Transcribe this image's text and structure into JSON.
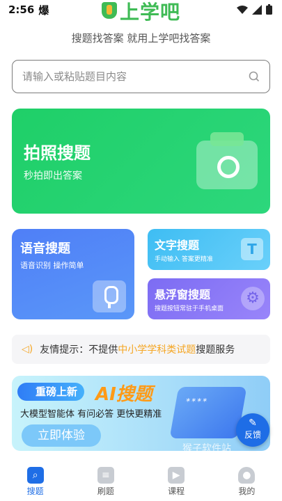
{
  "status_bar": {
    "time": "2:56",
    "extra": "爆"
  },
  "header": {
    "logo_text": "上学吧",
    "subtitle": "搜题找答案 就用上学吧找答案"
  },
  "search": {
    "placeholder": "请输入或粘贴题目内容",
    "value": ""
  },
  "cards": {
    "photo": {
      "title": "拍照搜题",
      "desc": "秒拍即出答案"
    },
    "voice": {
      "title": "语音搜题",
      "desc": "语音识别 操作简单"
    },
    "text": {
      "title": "文字搜题",
      "desc": "手动输入 答案更精准",
      "icon_glyph": "T"
    },
    "float": {
      "title": "悬浮窗搜题",
      "desc": "搜题按钮常驻于手机桌面"
    }
  },
  "notice": {
    "prefix": "友情提示：不提供",
    "highlight": "中小学学科类试题",
    "suffix": "搜题服务"
  },
  "banner": {
    "badge": "重磅上新",
    "headline": "AI搜题",
    "slogan": "大模型智能体  有问必答  更快更精准",
    "cta": "立即体验",
    "phone_text": "****"
  },
  "watermark": "猴子软件站",
  "fab": {
    "label": "反馈"
  },
  "tabs": [
    {
      "label": "搜题",
      "icon": "search-icon",
      "active": true
    },
    {
      "label": "刷题",
      "icon": "document-icon",
      "active": false
    },
    {
      "label": "课程",
      "icon": "play-icon",
      "active": false
    },
    {
      "label": "我的",
      "icon": "profile-icon",
      "active": false
    }
  ],
  "colors": {
    "brand_green": "#3fbb55",
    "photo_card": "#1fcf68",
    "voice_card": "#4f7ff7",
    "text_card": "#3ebdf3",
    "float_card": "#7c6cf3",
    "highlight": "#f5a623",
    "active_tab": "#1f6ee6"
  }
}
